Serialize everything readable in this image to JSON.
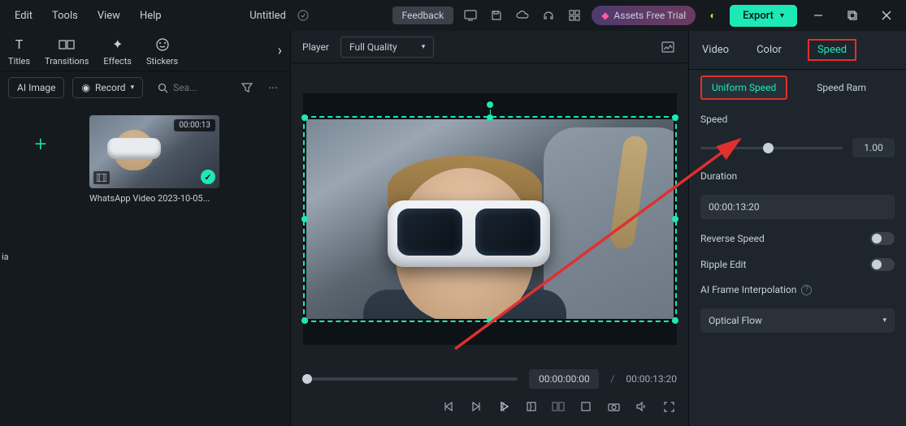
{
  "menu": {
    "edit": "Edit",
    "tools": "Tools",
    "view": "View",
    "help": "Help"
  },
  "document": {
    "name": "Untitled"
  },
  "titlebar": {
    "feedback": "Feedback",
    "assets": "Assets Free Trial",
    "export": "Export"
  },
  "left": {
    "tools": {
      "titles": "Titles",
      "transitions": "Transitions",
      "effects": "Effects",
      "stickers": "Stickers"
    },
    "ai_image": "AI Image",
    "record": "Record",
    "search_placeholder": "Sea...",
    "truncated": "ia",
    "clip": {
      "duration": "00:00:13",
      "name": "WhatsApp Video 2023-10-05..."
    }
  },
  "player": {
    "label": "Player",
    "quality": "Full Quality",
    "current_time": "00:00:00:00",
    "total_time": "00:00:13:20"
  },
  "right": {
    "tabs": {
      "video": "Video",
      "color": "Color",
      "speed": "Speed"
    },
    "subtabs": {
      "uniform": "Uniform Speed",
      "ramp": "Speed Ram"
    },
    "speed": {
      "label": "Speed",
      "value": "1.00",
      "duration_label": "Duration",
      "duration_value": "00:00:13:20",
      "reverse": "Reverse Speed",
      "ripple": "Ripple Edit",
      "interp": "AI Frame Interpolation",
      "interp_value": "Optical Flow"
    }
  }
}
